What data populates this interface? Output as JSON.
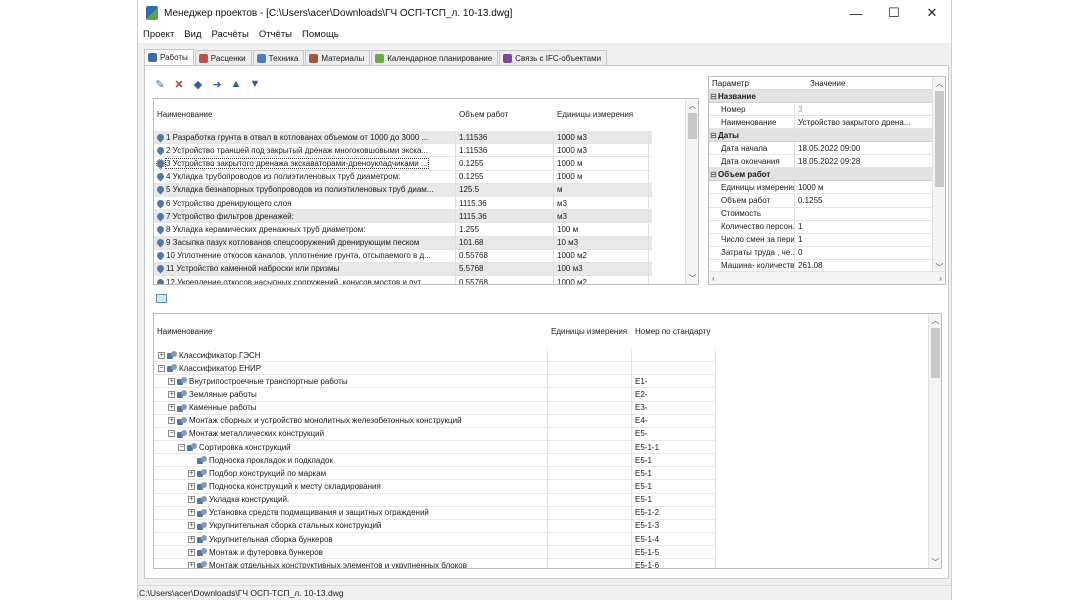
{
  "window": {
    "title": "Менеджер проектов - [C:\\Users\\acer\\Downloads\\ГЧ ОСП-ТСП_л. 10-13.dwg]",
    "minimize": "—",
    "maximize": "☐",
    "close": "✕"
  },
  "menu": [
    "Проект",
    "Вид",
    "Расчёты",
    "Отчёты",
    "Помощь"
  ],
  "tabs": [
    {
      "label": "Работы",
      "color": "#3a6ea5"
    },
    {
      "label": "Расценки",
      "color": "#c0504d"
    },
    {
      "label": "Техника",
      "color": "#4a7ebb"
    },
    {
      "label": "Материалы",
      "color": "#9b5a3c"
    },
    {
      "label": "Календарное планирование",
      "color": "#6aa84f"
    },
    {
      "label": "Связь с IFC-объектами",
      "color": "#7a4a9a"
    }
  ],
  "works_grid": {
    "headers": {
      "name": "Наименование",
      "volume": "Объем работ",
      "unit": "Единицы измерения"
    },
    "rows": [
      {
        "name": "1 Разработка грунта в отвал в котлованах объемом от 1000 до 3000 ...",
        "volume": "1.11536",
        "unit": "1000 м3"
      },
      {
        "name": "2 Устройство траншей под закрытый дренаж многоковшовыми экска...",
        "volume": "1.11536",
        "unit": "1000 м3"
      },
      {
        "name": "3 Устройство закрытого дренажа экскаваторами-дреноукладчиками ...",
        "volume": "0.1255",
        "unit": "1000 м"
      },
      {
        "name": "4 Укладка трубопроводов из полиэтиленовых труб диаметром:",
        "volume": "0.1255",
        "unit": "1000 м"
      },
      {
        "name": "5 Укладка безнапорных трубопроводов из полиэтиленовых труб диам...",
        "volume": "125.5",
        "unit": "м"
      },
      {
        "name": "6 Устройство дренирующего слоя",
        "volume": "1115.36",
        "unit": "м3"
      },
      {
        "name": "7 Устройство фильтров дренажей:",
        "volume": "1115.36",
        "unit": "м3"
      },
      {
        "name": "8 Укладка керамических дренажных труб диаметром:",
        "volume": "1.255",
        "unit": "100 м"
      },
      {
        "name": "9 Засыпка пазух котлованов спецсооружений дренирующим песком",
        "volume": "101.68",
        "unit": "10 м3"
      },
      {
        "name": "10 Уплотнение откосов каналов, уплотнение грунта, отсыпаемого в д...",
        "volume": "0.55768",
        "unit": "1000 м2"
      },
      {
        "name": "11 Устройство каменной наброски или призмы",
        "volume": "5.5768",
        "unit": "100 м3"
      },
      {
        "name": "12 Укрепление откосов насыпных сооружений, конусов мостов и пут...",
        "volume": "0.55768",
        "unit": "1000 м2"
      }
    ]
  },
  "properties": {
    "header_param": "Параметр",
    "header_value": "Значение",
    "groups": [
      {
        "title": "Название",
        "rows": [
          {
            "key": "Номер",
            "value": "3",
            "gray": true
          },
          {
            "key": "Наименование",
            "value": "Устройство закрытого дрена..."
          }
        ]
      },
      {
        "title": "Даты",
        "rows": [
          {
            "key": "Дата начала",
            "value": "18.05.2022 09:00"
          },
          {
            "key": "Дата окончания",
            "value": "18.05.2022 09:28"
          }
        ]
      },
      {
        "title": "Объем работ",
        "rows": [
          {
            "key": "Единицы измерения",
            "value": "1000 м"
          },
          {
            "key": "Объем работ",
            "value": "0.1255"
          },
          {
            "key": "Стоимость",
            "value": ""
          },
          {
            "key": "Количество персон...",
            "value": "1"
          },
          {
            "key": "Число смен за пери...",
            "value": "1"
          },
          {
            "key": "Затраты труда , че...",
            "value": "0"
          },
          {
            "key": "Машина- количеств...",
            "value": "261.08"
          }
        ]
      }
    ]
  },
  "classifier": {
    "headers": {
      "name": "Наименование",
      "unit": "Единицы измерения",
      "std": "Номер по стандарту"
    },
    "rows": [
      {
        "level": 0,
        "exp": "+",
        "name": "Классификатор ГЭСН",
        "std": ""
      },
      {
        "level": 0,
        "exp": "−",
        "name": "Классификатор ЕНИР",
        "std": ""
      },
      {
        "level": 1,
        "exp": "+",
        "name": "Внутрипостроечные транспортные работы",
        "std": "E1-"
      },
      {
        "level": 1,
        "exp": "+",
        "name": "Земляные работы",
        "std": "E2-"
      },
      {
        "level": 1,
        "exp": "+",
        "name": "Каменные работы",
        "std": "E3-"
      },
      {
        "level": 1,
        "exp": "+",
        "name": "Монтаж сборных и устройство монолитных железобетонных конструкций",
        "std": "E4-"
      },
      {
        "level": 1,
        "exp": "−",
        "name": "Монтаж металлических конструкций",
        "std": "E5-"
      },
      {
        "level": 2,
        "exp": "−",
        "name": "Сортировка конструкций",
        "std": "E5-1-1"
      },
      {
        "level": 3,
        "exp": "",
        "name": "Подноска прокладок и подкладок",
        "std": "E5-1"
      },
      {
        "level": 3,
        "exp": "+",
        "name": "Подбор конструкций по маркам",
        "std": "E5-1"
      },
      {
        "level": 3,
        "exp": "+",
        "name": "Подноска конструкций к месту складирования",
        "std": "E5-1"
      },
      {
        "level": 3,
        "exp": "+",
        "name": "Укладка конструкций.",
        "std": "E5-1"
      },
      {
        "level": 3,
        "exp": "+",
        "name": "Установка средств подмащивания и защитных ограждений",
        "std": "E5-1-2"
      },
      {
        "level": 3,
        "exp": "+",
        "name": "Укрупнительная сборка стальных конструкций",
        "std": "E5-1-3"
      },
      {
        "level": 3,
        "exp": "+",
        "name": "Укрупнительная сборка бункеров",
        "std": "E5-1-4"
      },
      {
        "level": 3,
        "exp": "+",
        "name": "Монтаж и футеровка бункеров",
        "std": "E5-1-5"
      },
      {
        "level": 3,
        "exp": "+",
        "name": "Монтаж отдельных конструктивных элементов и укрупненных блоков",
        "std": "E5-1-6"
      }
    ]
  },
  "status": "C:\\Users\\acer\\Downloads\\ГЧ ОСП-ТСП_л. 10-13.dwg"
}
